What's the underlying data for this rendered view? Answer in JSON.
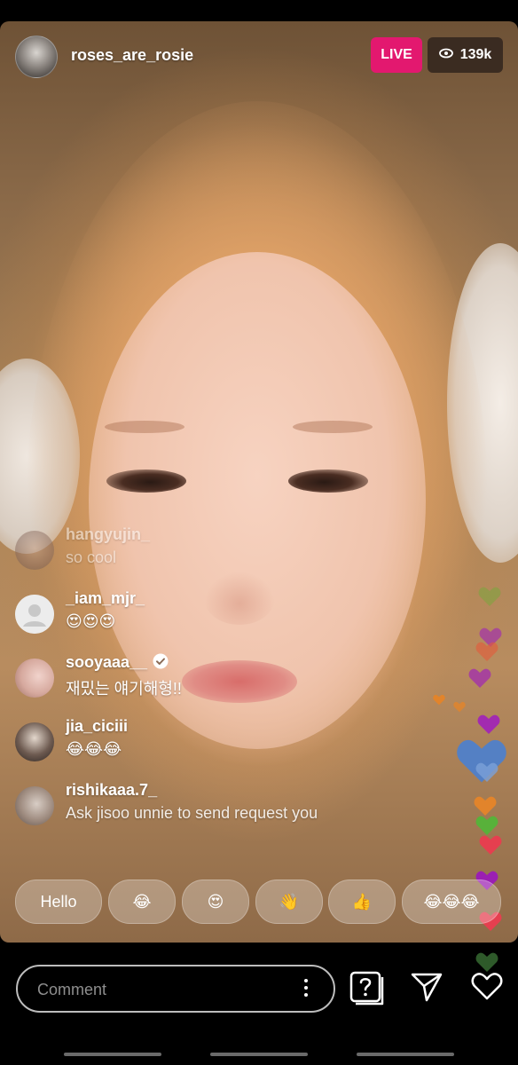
{
  "header": {
    "username": "roses_are_rosie",
    "live_label": "LIVE",
    "viewer_count": "139k"
  },
  "comments": [
    {
      "username": "hangyujin_",
      "text": "so cool",
      "verified": false
    },
    {
      "username": "_iam_mjr_",
      "text": "😍😍😍",
      "verified": false
    },
    {
      "username": "sooyaaa__",
      "text": "재밌는 얘기해형!!",
      "verified": true
    },
    {
      "username": "jia_ciciii",
      "text": "😂😂😂",
      "verified": false
    },
    {
      "username": "rishikaaa.7_",
      "text": "Ask jisoo unnie to send request you",
      "verified": false
    }
  ],
  "quick_reactions": [
    "Hello",
    "😂",
    "😍",
    "👋",
    "👍",
    "😂😂😂"
  ],
  "comment_input": {
    "placeholder": "Comment"
  },
  "icons": {
    "viewers": "eye-icon",
    "more": "more-vertical-icon",
    "questions": "question-icon",
    "share": "send-icon",
    "like": "heart-icon"
  },
  "colors": {
    "live_badge": "#e3186f",
    "background": "#000000"
  }
}
